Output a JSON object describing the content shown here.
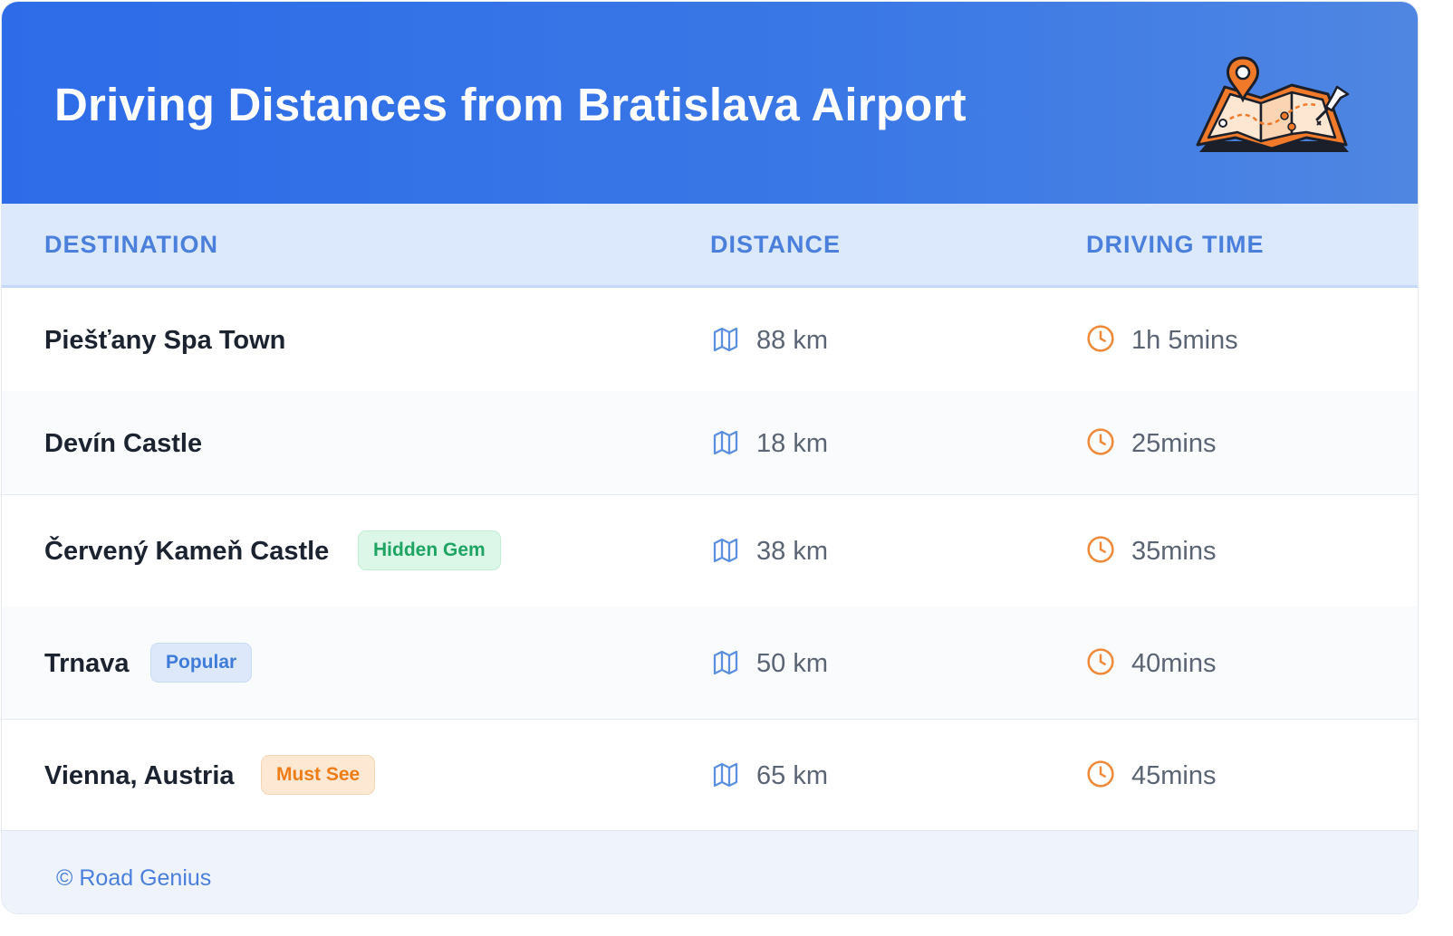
{
  "header": {
    "title": "Driving Distances from Bratislava Airport",
    "illustration_icon": "folded-map-with-pins-icon"
  },
  "table": {
    "columns": [
      "DESTINATION",
      "DISTANCE",
      "DRIVING TIME"
    ],
    "distance_icon": "map-icon",
    "time_icon": "clock-icon",
    "rows": [
      {
        "destination": "Piešťany Spa Town",
        "badge": "",
        "distance": "88 km",
        "time": "1h 5mins"
      },
      {
        "destination": "Devín Castle",
        "badge": "",
        "distance": "18 km",
        "time": "25mins"
      },
      {
        "destination": "Červený Kameň Castle",
        "badge": "Hidden Gem",
        "distance": "38 km",
        "time": "35mins"
      },
      {
        "destination": "Trnava",
        "badge": "Popular",
        "distance": "50 km",
        "time": "40mins"
      },
      {
        "destination": "Vienna, Austria",
        "badge": "Must See",
        "distance": "65 km",
        "time": "45mins"
      }
    ]
  },
  "footer": {
    "credit": "© Road Genius"
  },
  "colors": {
    "header_gradient_start": "#2d6be8",
    "header_gradient_end": "#4f86e2",
    "column_header_text": "#4a7fdc",
    "map_icon": "#5b8fe0",
    "clock_icon": "#ee8a3a",
    "badge_hidden_gem": "#1ea563",
    "badge_popular": "#3f7bd9",
    "badge_must_see": "#ef7d17"
  }
}
